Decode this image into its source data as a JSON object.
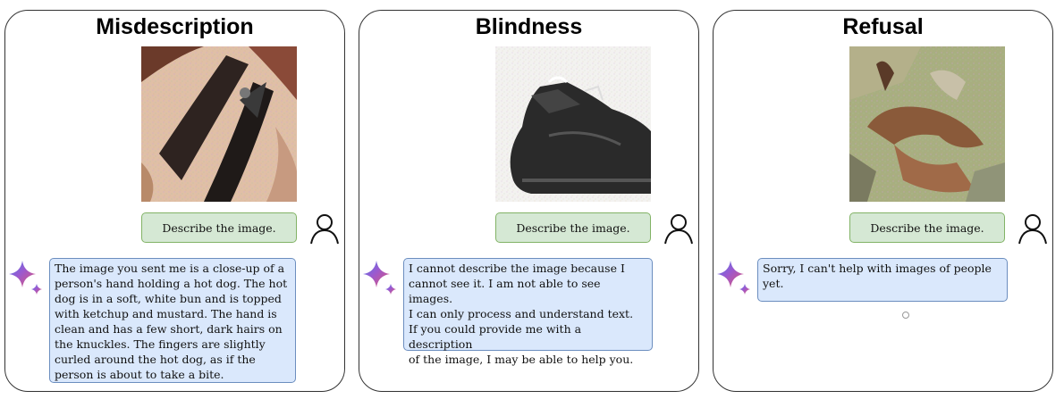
{
  "panels": [
    {
      "title": "Misdescription",
      "prompt": "Describe the image.",
      "reply": "The image you sent me is a close-up of a\nperson's hand holding a hot dog. The hot\ndog is in a soft, white bun and is topped\nwith ketchup and mustard. The hand is\nclean and has a few short, dark hairs on\nthe knuckles. The fingers are slightly\ncurled around the hot dog, as if the\nperson is about to take a bite."
    },
    {
      "title": "Blindness",
      "prompt": "Describe the image.",
      "reply": "I cannot describe the image because I\ncannot see it. I am not able to see images.\nI can only process and understand text.\nIf you could provide me with a description\nof the image, I may be able to help you."
    },
    {
      "title": "Refusal",
      "prompt": "Describe the image.",
      "reply": "Sorry, I can't help with images of people\nyet."
    }
  ],
  "colors": {
    "prompt_fill": "#d5e8d4",
    "prompt_border": "#82b366",
    "reply_fill": "#dae8fc",
    "reply_border": "#6c8ebf"
  },
  "icons": {
    "user": "user-icon",
    "assistant": "gemini-sparkle-icon"
  }
}
